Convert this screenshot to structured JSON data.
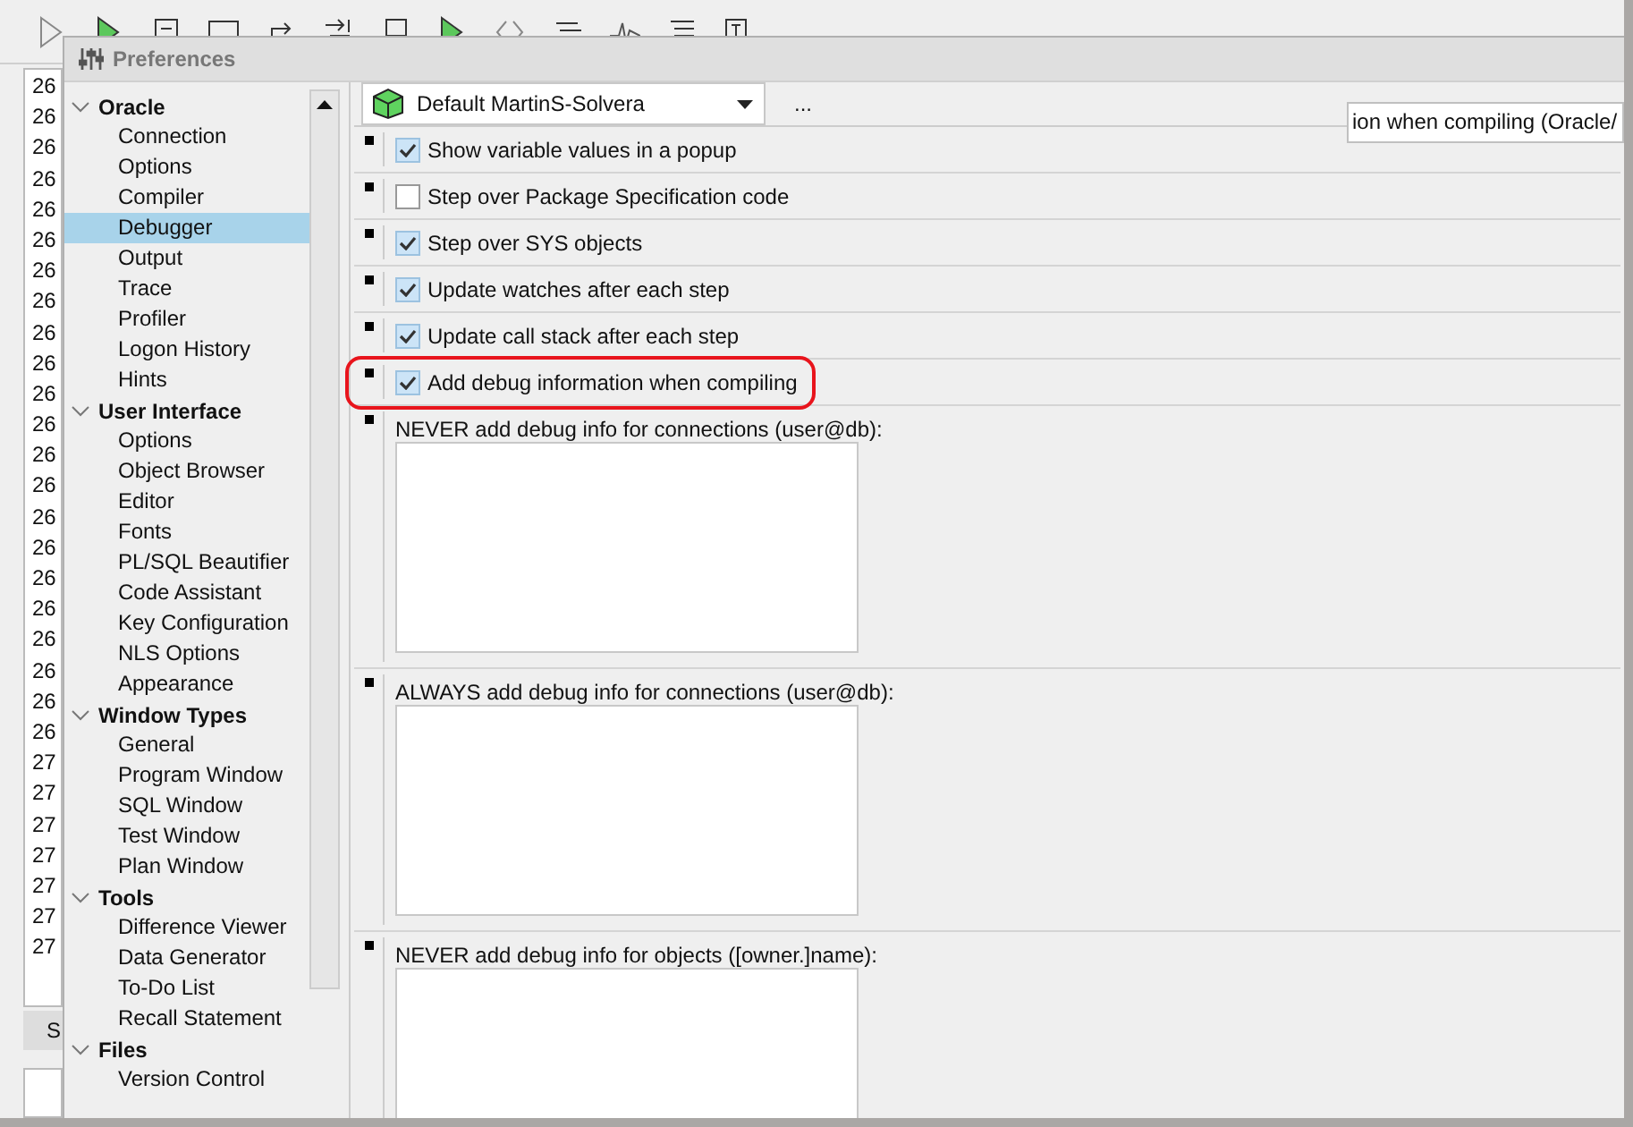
{
  "background_app": {
    "line_numbers": [
      "26",
      "26",
      "26",
      "26",
      "26",
      "26",
      "26",
      "26",
      "26",
      "26",
      "26",
      "26",
      "26",
      "26",
      "26",
      "26",
      "26",
      "26",
      "26",
      "26",
      "26",
      "26",
      "27",
      "27",
      "27",
      "27",
      "27",
      "27",
      "27"
    ],
    "tab": "S"
  },
  "dialog": {
    "title": "Preferences",
    "tree": [
      {
        "label": "Oracle",
        "expanded": true,
        "children": [
          {
            "label": "Connection",
            "selected": false
          },
          {
            "label": "Options",
            "selected": false
          },
          {
            "label": "Compiler",
            "selected": false
          },
          {
            "label": "Debugger",
            "selected": true
          },
          {
            "label": "Output",
            "selected": false
          },
          {
            "label": "Trace",
            "selected": false
          },
          {
            "label": "Profiler",
            "selected": false
          },
          {
            "label": "Logon History",
            "selected": false
          },
          {
            "label": "Hints",
            "selected": false
          }
        ]
      },
      {
        "label": "User Interface",
        "expanded": true,
        "children": [
          {
            "label": "Options",
            "selected": false
          },
          {
            "label": "Object Browser",
            "selected": false
          },
          {
            "label": "Editor",
            "selected": false
          },
          {
            "label": "Fonts",
            "selected": false
          },
          {
            "label": "PL/SQL Beautifier",
            "selected": false
          },
          {
            "label": "Code Assistant",
            "selected": false
          },
          {
            "label": "Key Configuration",
            "selected": false
          },
          {
            "label": "NLS Options",
            "selected": false
          },
          {
            "label": "Appearance",
            "selected": false
          }
        ]
      },
      {
        "label": "Window Types",
        "expanded": true,
        "children": [
          {
            "label": "General",
            "selected": false
          },
          {
            "label": "Program Window",
            "selected": false
          },
          {
            "label": "SQL Window",
            "selected": false
          },
          {
            "label": "Test Window",
            "selected": false
          },
          {
            "label": "Plan Window",
            "selected": false
          }
        ]
      },
      {
        "label": "Tools",
        "expanded": true,
        "children": [
          {
            "label": "Difference Viewer",
            "selected": false
          },
          {
            "label": "Data Generator",
            "selected": false
          },
          {
            "label": "To-Do List",
            "selected": false
          },
          {
            "label": "Recall Statement",
            "selected": false
          }
        ]
      },
      {
        "label": "Files",
        "expanded": true,
        "children": [
          {
            "label": "Version Control",
            "selected": false
          }
        ]
      }
    ],
    "profile_select": {
      "value": "Default MartinS-Solvera"
    },
    "more_button": "...",
    "description_field": {
      "value": "ion when compiling (Oracle/"
    },
    "options": [
      {
        "kind": "checkbox",
        "label": "Show variable values in a popup",
        "checked": true,
        "highlighted": false
      },
      {
        "kind": "checkbox",
        "label": "Step over Package Specification code",
        "checked": false,
        "highlighted": false
      },
      {
        "kind": "checkbox",
        "label": "Step over SYS objects",
        "checked": true,
        "highlighted": false
      },
      {
        "kind": "checkbox",
        "label": "Update watches after each step",
        "checked": true,
        "highlighted": false
      },
      {
        "kind": "checkbox",
        "label": "Update call stack after each step",
        "checked": true,
        "highlighted": false
      },
      {
        "kind": "checkbox",
        "label": "Add debug information when compiling",
        "checked": true,
        "highlighted": true
      },
      {
        "kind": "list",
        "label": "NEVER add debug info for connections (user@db):"
      },
      {
        "kind": "list",
        "label": "ALWAYS add debug info for connections (user@db):"
      },
      {
        "kind": "list",
        "label": "NEVER add debug info for objects ([owner.]name):"
      }
    ]
  }
}
